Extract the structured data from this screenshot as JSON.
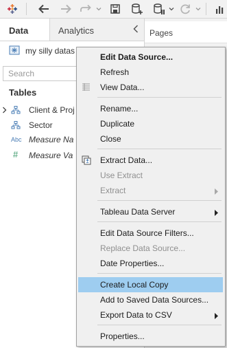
{
  "pane": {
    "tab_data": "Data",
    "tab_analytics": "Analytics",
    "datasource_name": "my silly datas",
    "search_placeholder": "Search",
    "tables_title": "Tables",
    "fields": [
      {
        "label": "Client & Proj",
        "icon": "hierarchy-icon",
        "italic": false,
        "expandable": true
      },
      {
        "label": "Sector",
        "icon": "hierarchy-icon",
        "italic": false,
        "expandable": false
      },
      {
        "label": "Measure Na",
        "icon": "abc-icon",
        "italic": true,
        "expandable": false
      },
      {
        "label": "Measure Va",
        "icon": "hash-icon",
        "italic": true,
        "expandable": false
      }
    ]
  },
  "pages_panel": {
    "title": "Pages"
  },
  "context_menu": {
    "items": {
      "edit_data_source": "Edit Data Source...",
      "refresh": "Refresh",
      "view_data": "View Data...",
      "rename": "Rename...",
      "duplicate": "Duplicate",
      "close": "Close",
      "extract_data": "Extract Data...",
      "use_extract": "Use Extract",
      "extract": "Extract",
      "tableau_data_server": "Tableau Data Server",
      "edit_data_source_filters": "Edit Data Source Filters...",
      "replace_data_source": "Replace Data Source...",
      "date_properties": "Date Properties...",
      "create_local_copy": "Create Local Copy",
      "add_to_saved_data_sources": "Add to Saved Data Sources...",
      "export_data_to_csv": "Export Data to CSV",
      "properties": "Properties..."
    },
    "highlighted_item": "Create Local Copy",
    "highlight_color": "#9ecdf0"
  },
  "colors": {
    "toolbar_bg": "#f2f2f2",
    "menu_bg": "#f0f0f0",
    "accent_icon": "#4a7db5"
  }
}
